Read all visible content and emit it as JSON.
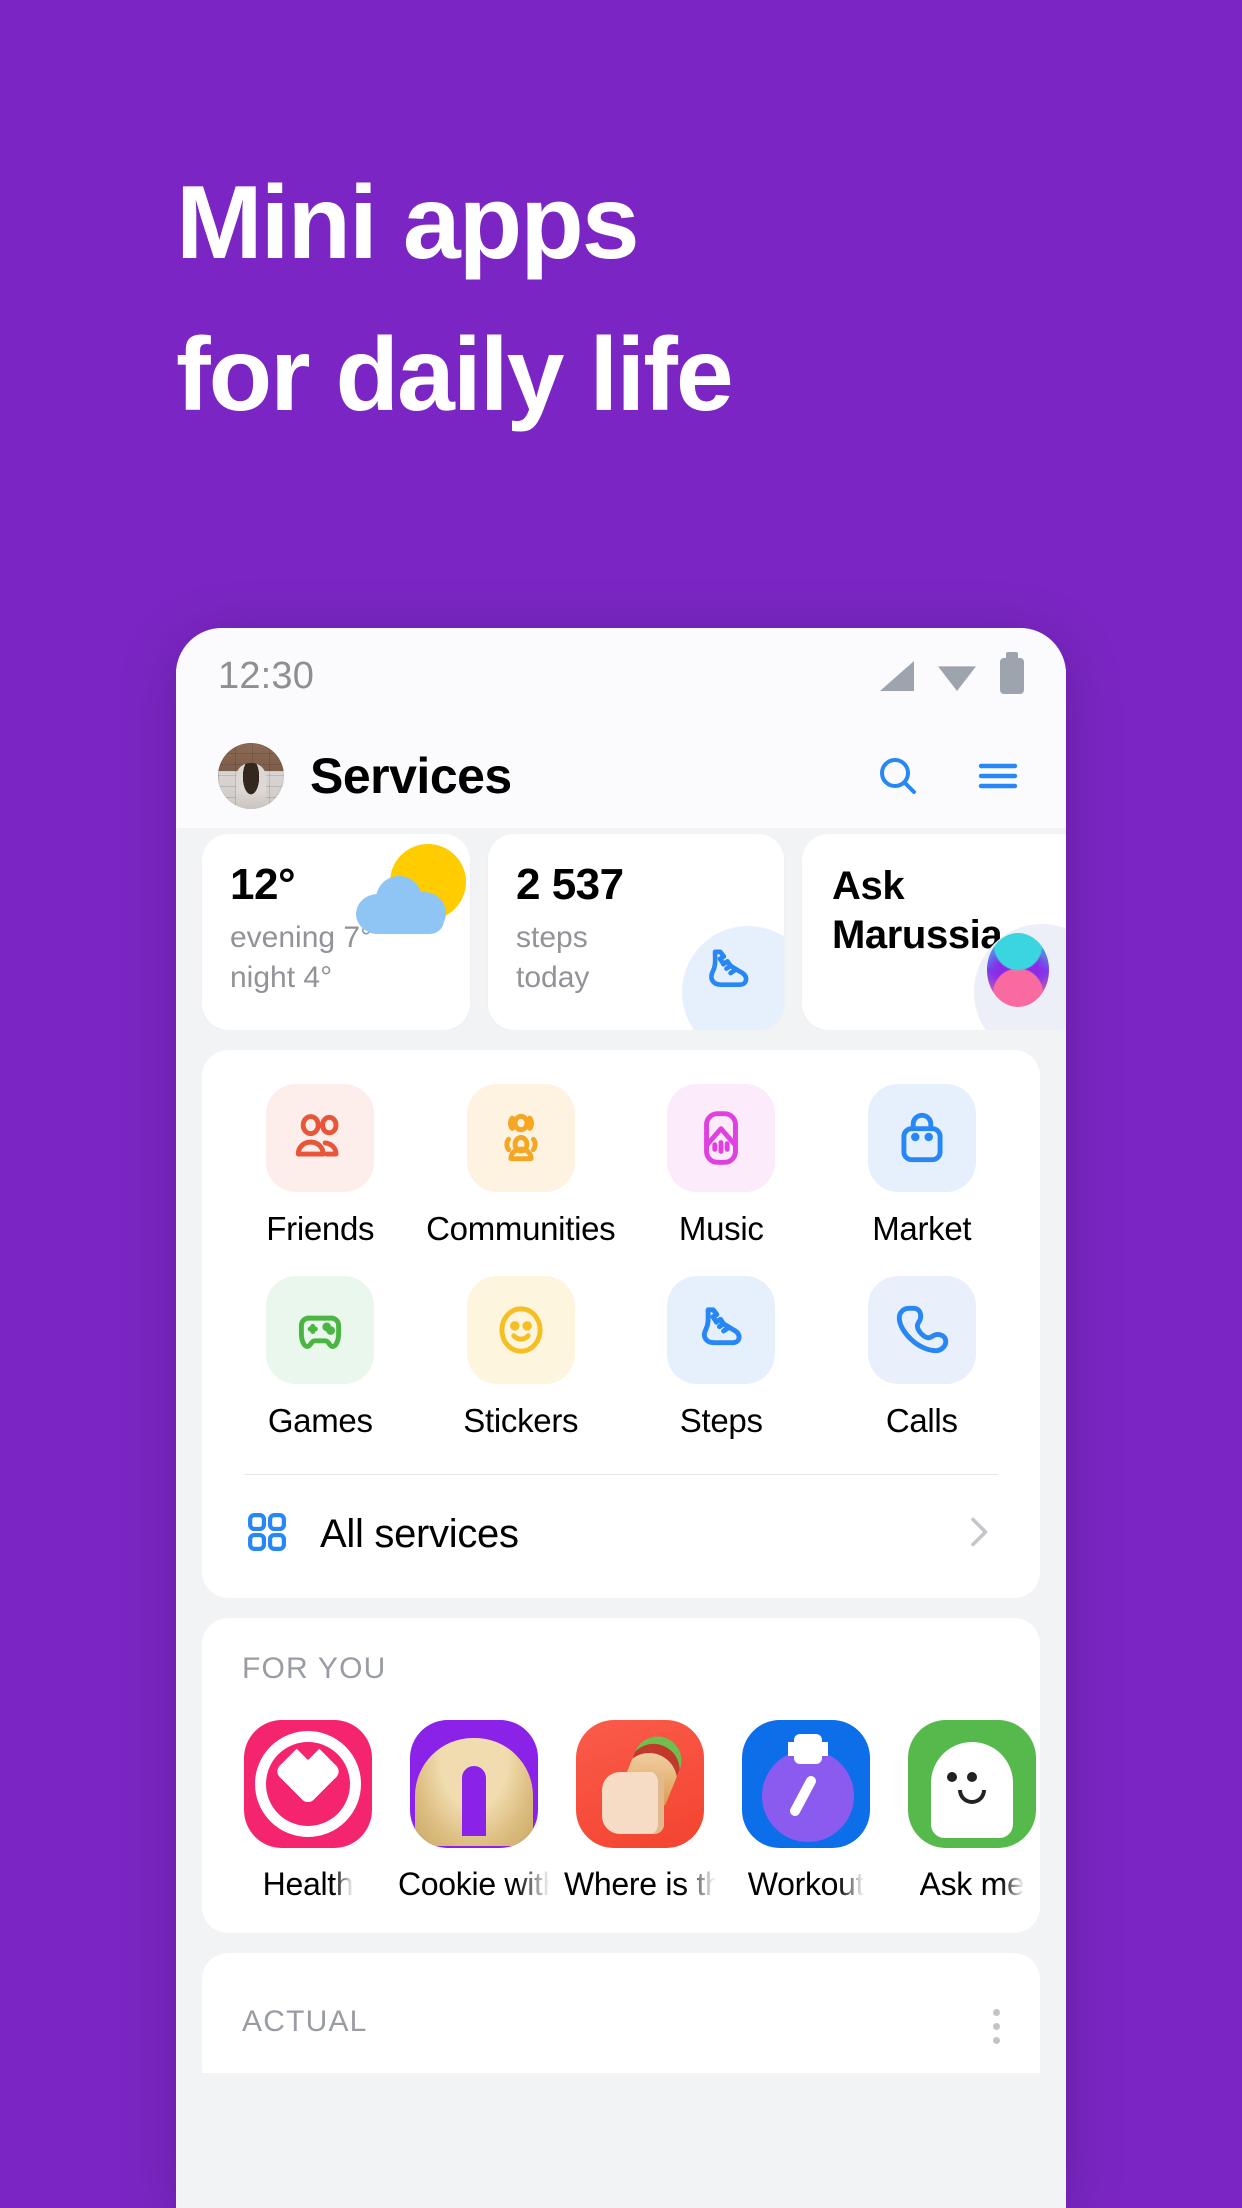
{
  "promo": {
    "headline": "Mini apps\nfor daily life",
    "background_color": "#7B26C4"
  },
  "statusbar": {
    "time": "12:30",
    "icons": [
      "signal-icon",
      "wifi-icon",
      "battery-icon"
    ]
  },
  "appbar": {
    "title": "Services",
    "avatar": "user-avatar",
    "search": "search-icon",
    "menu": "hamburger-menu-icon"
  },
  "widgets": {
    "weather": {
      "temperature": "12°",
      "forecast": "evening 7°\nnight 4°",
      "icon": "sun-behind-cloud-icon"
    },
    "steps": {
      "count": "2 537",
      "label": "steps\ntoday",
      "icon": "sneaker-icon"
    },
    "assistant": {
      "title": "Ask\nMarussia",
      "icon": "assistant-orb-icon"
    }
  },
  "services": {
    "items": [
      {
        "label": "Friends",
        "icon": "friends-icon",
        "bg": "#FDEEEC",
        "fg": "#E8563A"
      },
      {
        "label": "Communities",
        "icon": "communities-icon",
        "bg": "#FEF3E0",
        "fg": "#F5A623"
      },
      {
        "label": "Music",
        "icon": "music-icon",
        "bg": "#FBEBFB",
        "fg": "#E040E0"
      },
      {
        "label": "Market",
        "icon": "market-bag-icon",
        "bg": "#E6F0FC",
        "fg": "#2787F5"
      },
      {
        "label": "Games",
        "icon": "gamepad-icon",
        "bg": "#EAF7EC",
        "fg": "#4BB543"
      },
      {
        "label": "Stickers",
        "icon": "smiley-icon",
        "bg": "#FEF5DF",
        "fg": "#F5BF23"
      },
      {
        "label": "Steps",
        "icon": "sneaker-icon",
        "bg": "#E6F0FC",
        "fg": "#2787F5"
      },
      {
        "label": "Calls",
        "icon": "phone-icon",
        "bg": "#E9EFFB",
        "fg": "#2787F5"
      }
    ],
    "all_services_label": "All services",
    "all_services_icon": "grid-icon",
    "chevron": "chevron-right-icon"
  },
  "for_you": {
    "section_title": "FOR YOU",
    "apps": [
      {
        "label": "Health",
        "icon": "health-target-icon",
        "art": "art-health"
      },
      {
        "label": "Cookie with",
        "icon": "fortune-cookie-icon",
        "art": "art-cookie"
      },
      {
        "label": "Where is the",
        "icon": "shawarma-hand-icon",
        "art": "art-where"
      },
      {
        "label": "Workout",
        "icon": "stopwatch-icon",
        "art": "art-workout"
      },
      {
        "label": "Ask me",
        "icon": "ghost-icon",
        "art": "art-ask"
      }
    ]
  },
  "actual": {
    "section_title": "ACTUAL",
    "menu_icon": "kebab-menu-icon"
  }
}
